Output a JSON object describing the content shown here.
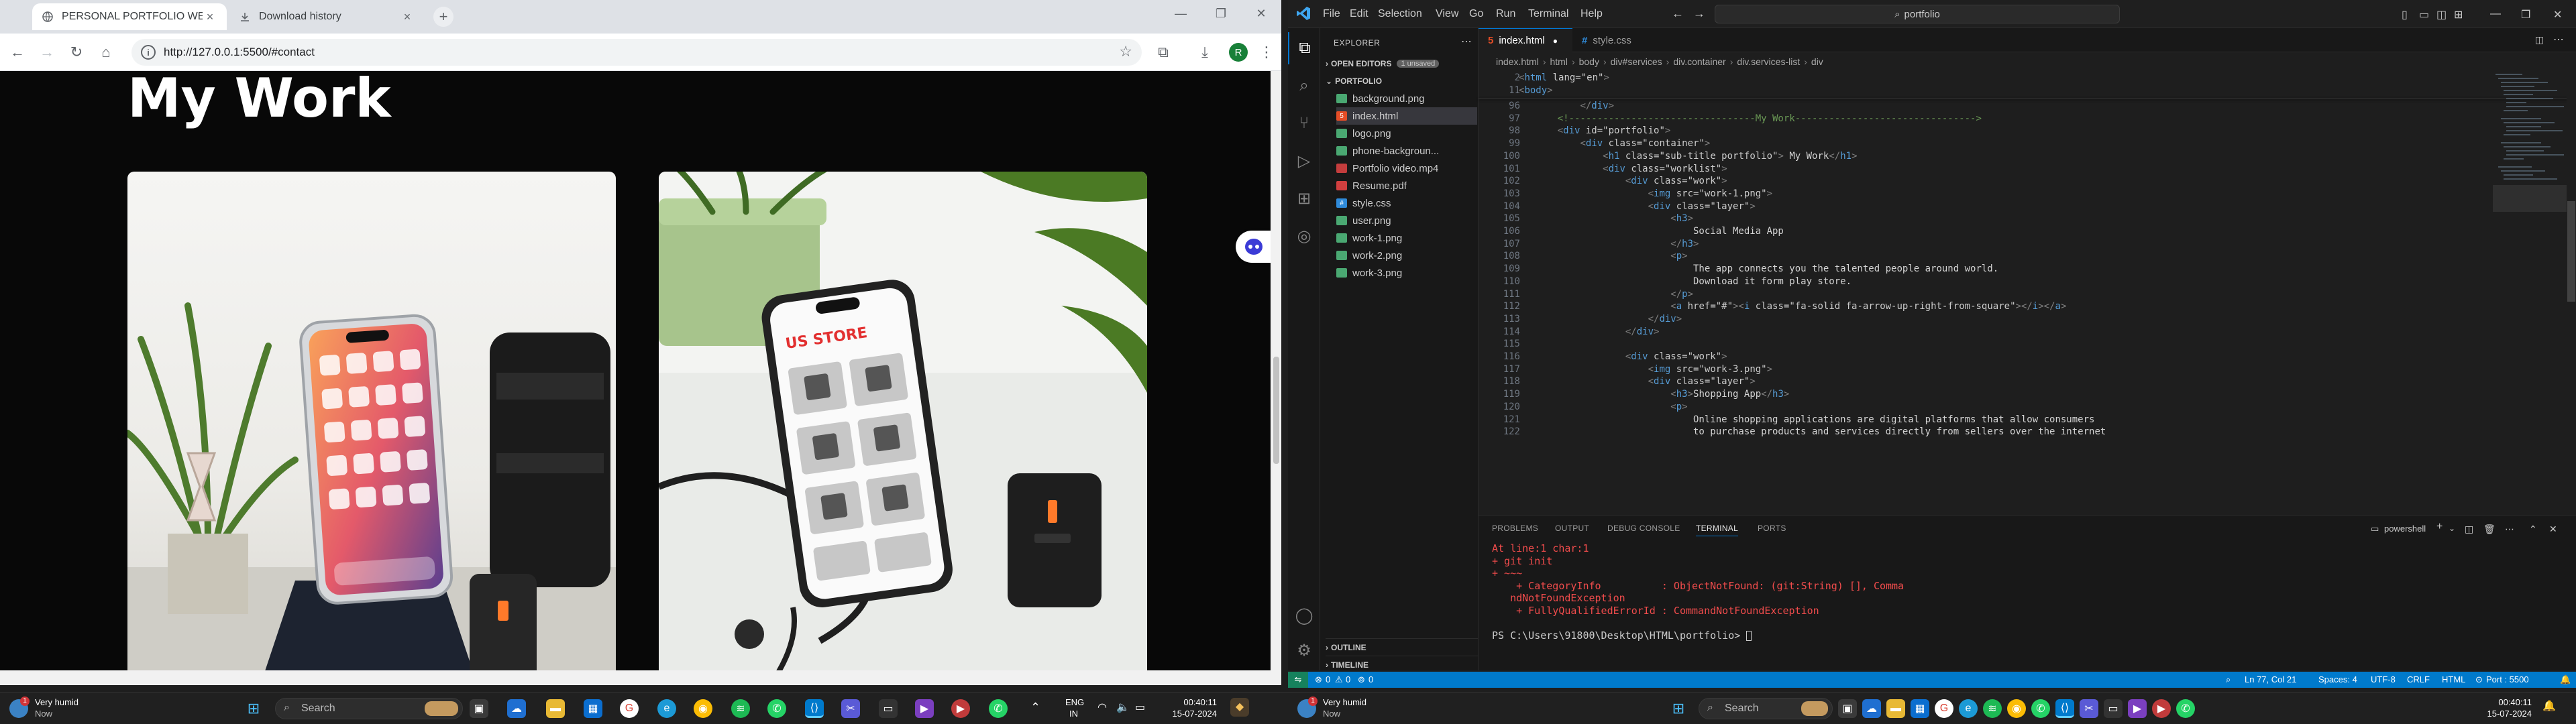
{
  "chrome": {
    "tabs": [
      {
        "title": "PERSONAL PORTFOLIO WEBSIT",
        "active": true
      },
      {
        "title": "Download history",
        "active": false
      }
    ],
    "url": "http://127.0.0.1:5500/#contact",
    "avatar_letter": "R"
  },
  "page": {
    "heading": "My Work",
    "cards": [
      {
        "image": "phone-on-stand"
      },
      {
        "image": "phone-store-app"
      }
    ]
  },
  "vscode": {
    "menu": [
      "File",
      "Edit",
      "Selection",
      "View",
      "Go",
      "Run",
      "Terminal",
      "Help"
    ],
    "search": "portfolio",
    "explorer_title": "EXPLORER",
    "open_editors": "OPEN EDITORS",
    "unsaved": "1 unsaved",
    "folder": "PORTFOLIO",
    "files": [
      "background.png",
      "index.html",
      "logo.png",
      "phone-backgroun...",
      "Portfolio video.mp4",
      "Resume.pdf",
      "style.css",
      "user.png",
      "work-1.png",
      "work-2.png",
      "work-3.png"
    ],
    "selected_file": "index.html",
    "editor_tabs": [
      {
        "label": "index.html",
        "active": true
      },
      {
        "label": "style.css",
        "active": false
      }
    ],
    "breadcrumbs": [
      "index.html",
      "html",
      "body",
      "div#services",
      "div.container",
      "div.services-list",
      "div"
    ],
    "sticky": [
      {
        "ln": "2",
        "code": "<html lang=\"en\">"
      },
      {
        "ln": "11",
        "code": "<body>"
      }
    ],
    "lines": [
      {
        "ln": "96",
        "code": "        </div>"
      },
      {
        "ln": "97",
        "code": "    <!---------------------------------My Work-------------------------------->"
      },
      {
        "ln": "98",
        "code": "    <div id=\"portfolio\">"
      },
      {
        "ln": "99",
        "code": "        <div class=\"container\">"
      },
      {
        "ln": "100",
        "code": "            <h1 class=\"sub-title portfolio\"> My Work</h1>"
      },
      {
        "ln": "101",
        "code": "            <div class=\"worklist\">"
      },
      {
        "ln": "102",
        "code": "                <div class=\"work\">"
      },
      {
        "ln": "103",
        "code": "                    <img src=\"work-1.png\">"
      },
      {
        "ln": "104",
        "code": "                    <div class=\"layer\">"
      },
      {
        "ln": "105",
        "code": "                        <h3>"
      },
      {
        "ln": "106",
        "code": "                            Social Media App"
      },
      {
        "ln": "107",
        "code": "                        </h3>"
      },
      {
        "ln": "108",
        "code": "                        <p>"
      },
      {
        "ln": "109",
        "code": "                            The app connects you the talented people around world."
      },
      {
        "ln": "110",
        "code": "                            Download it form play store."
      },
      {
        "ln": "111",
        "code": "                        </p>"
      },
      {
        "ln": "112",
        "code": "                        <a href=\"#\"><i class=\"fa-solid fa-arrow-up-right-from-square\"></i></a>"
      },
      {
        "ln": "113",
        "code": "                    </div>"
      },
      {
        "ln": "114",
        "code": "                </div>"
      },
      {
        "ln": "115",
        "code": ""
      },
      {
        "ln": "116",
        "code": "                <div class=\"work\">"
      },
      {
        "ln": "117",
        "code": "                    <img src=\"work-3.png\">"
      },
      {
        "ln": "118",
        "code": "                    <div class=\"layer\">"
      },
      {
        "ln": "119",
        "code": "                        <h3>Shopping App</h3>"
      },
      {
        "ln": "120",
        "code": "                        <p>"
      },
      {
        "ln": "121",
        "code": "                            Online shopping applications are digital platforms that allow consumers"
      },
      {
        "ln": "122",
        "code": "                            to purchase products and services directly from sellers over the internet"
      }
    ],
    "panel_tabs": [
      "PROBLEMS",
      "OUTPUT",
      "DEBUG CONSOLE",
      "TERMINAL",
      "PORTS"
    ],
    "active_panel": "TERMINAL",
    "shell": "powershell",
    "terminal": [
      {
        "text": "At line:1 char:1",
        "color": "#f14c4c"
      },
      {
        "text": "+ git init",
        "color": "#f14c4c"
      },
      {
        "text": "+ ~~~",
        "color": "#f14c4c"
      },
      {
        "text": "    + CategoryInfo          : ObjectNotFound: (git:String) [], Comma",
        "color": "#f14c4c"
      },
      {
        "text": "   ndNotFoundException",
        "color": "#f14c4c"
      },
      {
        "text": "    + FullyQualifiedErrorId : CommandNotFoundException",
        "color": "#f14c4c"
      },
      {
        "text": "",
        "color": "#cccccc"
      },
      {
        "text": "PS C:\\Users\\91800\\Desktop\\HTML\\portfolio> ",
        "color": "#cccccc"
      }
    ],
    "outline": "OUTLINE",
    "timeline": "TIMELINE",
    "status": {
      "errors": "0",
      "warnings": "0",
      "ports": "0",
      "position": "Ln 77, Col 21",
      "spaces": "Spaces: 4",
      "encoding": "UTF-8",
      "eol": "CRLF",
      "language": "HTML",
      "port": "Port : 5500"
    }
  },
  "taskbar_left": {
    "weather": "Very humid",
    "weather_sub": "Now",
    "search": "Search",
    "lang": "ENG",
    "region": "IN",
    "time": "00:40:11",
    "date": "15-07-2024"
  },
  "taskbar_right": {
    "weather": "Very humid",
    "weather_sub": "Now",
    "search": "Search",
    "time": "00:40:11",
    "date": "15-07-2024"
  },
  "colors": {
    "vscode_accent": "#007acc",
    "chrome_tabstrip": "#dee1e6",
    "error_red": "#f14c4c"
  }
}
